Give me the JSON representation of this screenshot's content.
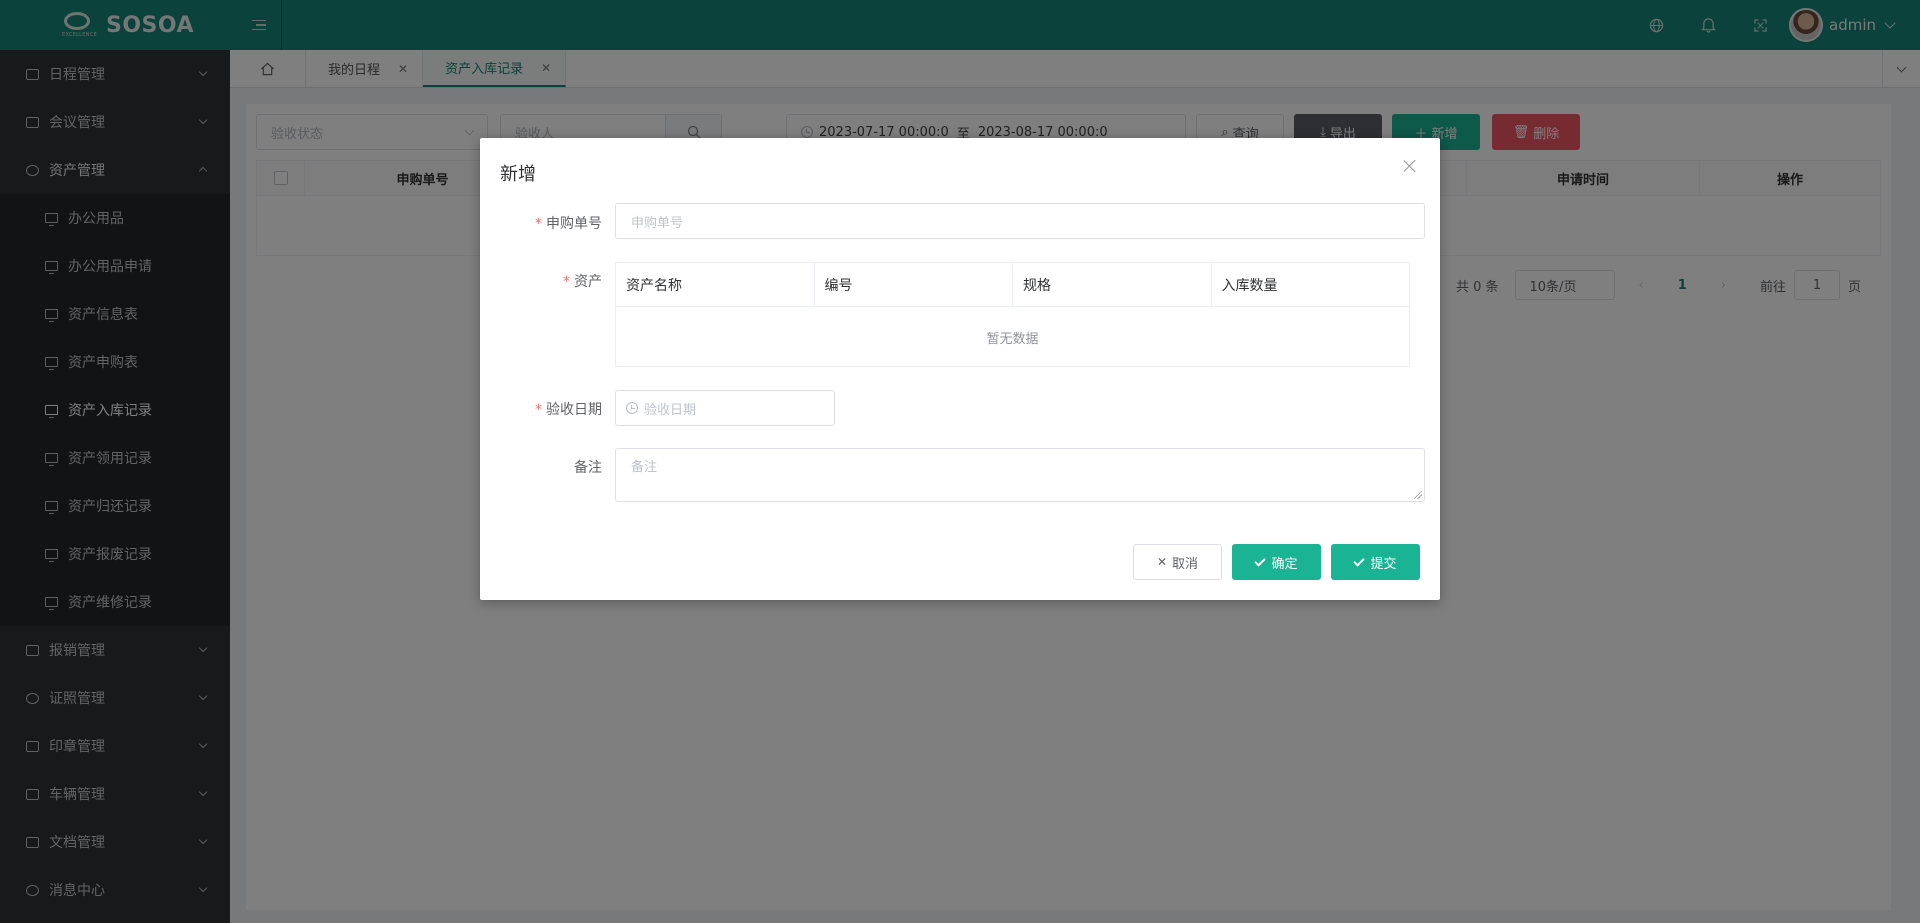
{
  "app": {
    "brand": "SOSOA",
    "logo_subtext": "EXCELLENCE",
    "username": "admin"
  },
  "sidebar": {
    "groups": [
      {
        "label": "日程管理",
        "icon": "calendar-icon"
      },
      {
        "label": "会议管理",
        "icon": "meeting-icon"
      },
      {
        "label": "资产管理",
        "icon": "asset-icon",
        "expanded": true,
        "items": [
          "办公用品",
          "办公用品申请",
          "资产信息表",
          "资产申购表",
          "资产入库记录",
          "资产领用记录",
          "资产归还记录",
          "资产报废记录",
          "资产维修记录"
        ],
        "active_item": "资产入库记录"
      },
      {
        "label": "报销管理",
        "icon": "reimburse-icon"
      },
      {
        "label": "证照管理",
        "icon": "license-icon"
      },
      {
        "label": "印章管理",
        "icon": "seal-icon"
      },
      {
        "label": "车辆管理",
        "icon": "car-icon"
      },
      {
        "label": "文档管理",
        "icon": "folder-icon"
      },
      {
        "label": "消息中心",
        "icon": "gear-icon"
      }
    ]
  },
  "tabs": [
    {
      "label": "我的日程",
      "active": false
    },
    {
      "label": "资产入库记录",
      "active": true
    }
  ],
  "filters": {
    "status_placeholder": "验收状态",
    "acceptor_placeholder": "验收人",
    "date_start": "2023-07-17 00:00:0",
    "date_sep": "至",
    "date_end": "2023-08-17 00:00:0",
    "query_label": "查询",
    "export_label": "导出",
    "add_label": "新增",
    "delete_label": "删除"
  },
  "table": {
    "columns": [
      "申购单号",
      "申请时间",
      "操作"
    ]
  },
  "pagination": {
    "total_text": "共 0 条",
    "page_size": "10条/页",
    "current_page": "1",
    "goto_label": "前往",
    "goto_value": "1",
    "page_suffix": "页"
  },
  "dialog": {
    "title": "新增",
    "fields": {
      "purchase_no_label": "申购单号",
      "purchase_no_placeholder": "申购单号",
      "asset_label": "资产",
      "asset_columns": [
        "资产名称",
        "编号",
        "规格",
        "入库数量"
      ],
      "asset_empty": "暂无数据",
      "accept_date_label": "验收日期",
      "accept_date_placeholder": "验收日期",
      "remark_label": "备注",
      "remark_placeholder": "备注"
    },
    "buttons": {
      "cancel": "取消",
      "confirm": "确定",
      "submit": "提交"
    }
  },
  "colors": {
    "brand": "#178476",
    "primary": "#1ab394",
    "danger": "#f56c6c",
    "sidebar_bg": "#2f3235"
  }
}
